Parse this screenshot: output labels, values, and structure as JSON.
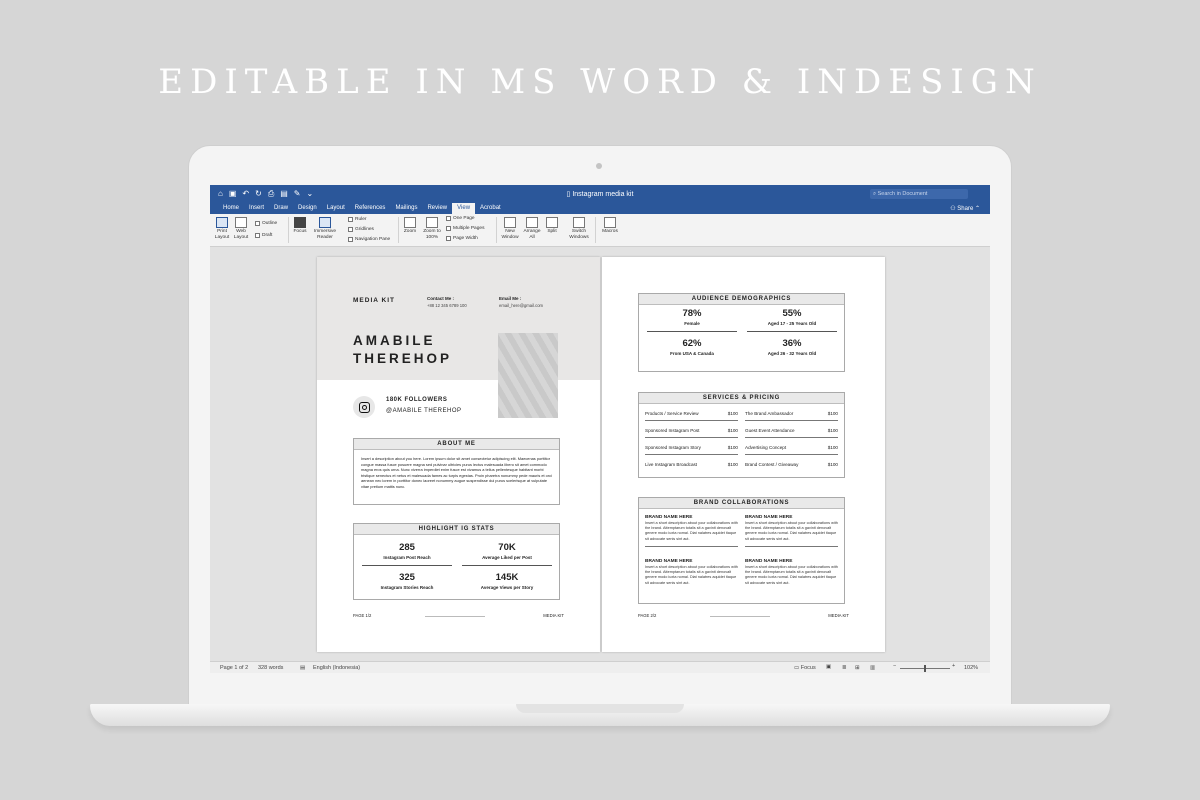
{
  "headline": "EDITABLE IN MS WORD & INDESIGN",
  "window": {
    "title": "Instagram media kit",
    "search_placeholder": "Search in Document",
    "share_label": "Share"
  },
  "tabs": [
    "Home",
    "Insert",
    "Draw",
    "Design",
    "Layout",
    "References",
    "Mailings",
    "Review",
    "View",
    "Acrobat"
  ],
  "active_tab": "View",
  "ribbon": {
    "print_layout": "Print Layout",
    "web_layout": "Web Layout",
    "outline": "Outline",
    "draft": "Draft",
    "focus": "Focus",
    "immersive_reader": "Immersive Reader",
    "ruler": "Ruler",
    "gridlines": "Gridlines",
    "navigation_pane": "Navigation Pane",
    "zoom": "Zoom",
    "zoom_100": "Zoom to 100%",
    "one_page": "One Page",
    "multiple_pages": "Multiple Pages",
    "page_width": "Page Width",
    "new_window": "New Window",
    "arrange_all": "Arrange All",
    "split": "Split",
    "switch_windows": "Switch Windows",
    "macros": "Macros"
  },
  "page1": {
    "media_kit": "MEDIA KIT",
    "contact_label": "Contact Me :",
    "contact_value": "+88 12 345 6789 100",
    "email_label": "Email Me :",
    "email_value": "email_here@gmail.com",
    "name_line1": "AMABILE",
    "name_line2": "THEREHOP",
    "followers": "180K FOLLOWERS",
    "handle": "@AMABILE THEREHOP",
    "about_title": "ABOUT ME",
    "about_text": "Insert a description about you here. Lorem ipsum dolor sit amet consectetur adipiscing elit. Maecenas porttitor congue massa fusce posuere magna sed pulvinar ultricies purus lectus malesuada libero sit amet commodo magna eros quis urna. Nunc viverra imperdiet enim fusce est vivamus a tellus pellentesque habitant morbi tristique senectus et netus et malesuada fames ac turpis egestas. Proin pharetra nonummy pede mauris et orci aenean nec lorem in porttitor donec laoreet nonummy augue suspendisse dui purus scelerisque at vulputate vitae pretium mattis nunc.",
    "stats_title": "HIGHLIGHT IG STATS",
    "stats": [
      {
        "value": "285",
        "label": "Instagram Post Reach"
      },
      {
        "value": "70K",
        "label": "Average Liked per Post"
      },
      {
        "value": "325",
        "label": "Instagram Stories Reach"
      },
      {
        "value": "145K",
        "label": "Average Views per Story"
      }
    ],
    "footer_left": "PAGE 1/2",
    "footer_right": "MEDIA KIT"
  },
  "page2": {
    "demo_title": "AUDIENCE DEMOGRAPHICS",
    "demographics": [
      {
        "value": "78%",
        "label": "Female"
      },
      {
        "value": "55%",
        "label": "Aged 17 - 25 Years Old"
      },
      {
        "value": "62%",
        "label": "From USA & Canada"
      },
      {
        "value": "36%",
        "label": "Aged 26 - 32 Years Old"
      }
    ],
    "services_title": "SERVICES & PRICING",
    "services": [
      {
        "name": "Products / Service Review",
        "price": "$100"
      },
      {
        "name": "The Brand Ambassador",
        "price": "$100"
      },
      {
        "name": "Sponsored Instagram Post",
        "price": "$100"
      },
      {
        "name": "Guest Event Attendance",
        "price": "$100"
      },
      {
        "name": "Sponsored Instagram Story",
        "price": "$100"
      },
      {
        "name": "Advertising Concept",
        "price": "$100"
      },
      {
        "name": "Live Instagram Broadcast",
        "price": "$100"
      },
      {
        "name": "Brand Contest / Giveaway",
        "price": "$100"
      }
    ],
    "collab_title": "BRAND COLLABORATIONS",
    "collabs": [
      {
        "title": "BRAND NAME HERE",
        "text": "Insert a short description about your collaborations with the brand. Attemptarum totalis sit a gavinit denovalt genere modo iuxta nomal. Diat nalatres aquidet itaque sit advocate senis sint aut."
      },
      {
        "title": "BRAND NAME HERE",
        "text": "Insert a short description about your collaborations with the brand. Attemptarum totalis sit a gavinit denovalt genere modo iuxta nomal. Diat nalatres aquidet itaque sit advocate senis sint aut."
      },
      {
        "title": "BRAND NAME HERE",
        "text": "Insert a short description about your collaborations with the brand. Attemptarum totalis sit a gavinit denovalt genere modo iuxta nomal. Diat nalatres aquidet itaque sit advocate senis sint aut."
      },
      {
        "title": "BRAND NAME HERE",
        "text": "Insert a short description about your collaborations with the brand. Attemptarum totalis sit a gavinit denovalt genere modo iuxta nomal. Diat nalatres aquidet itaque sit advocate senis sint aut."
      }
    ],
    "footer_left": "PAGE 2/2",
    "footer_right": "MEDIA KIT"
  },
  "status": {
    "page": "Page 1 of 2",
    "words": "328 words",
    "language": "English (Indonesia)",
    "focus": "Focus",
    "zoom_minus": "−",
    "zoom_plus": "+",
    "zoom": "102%"
  },
  "colors": {
    "ribbon_blue": "#2b579a",
    "background": "#d6d6d6"
  }
}
